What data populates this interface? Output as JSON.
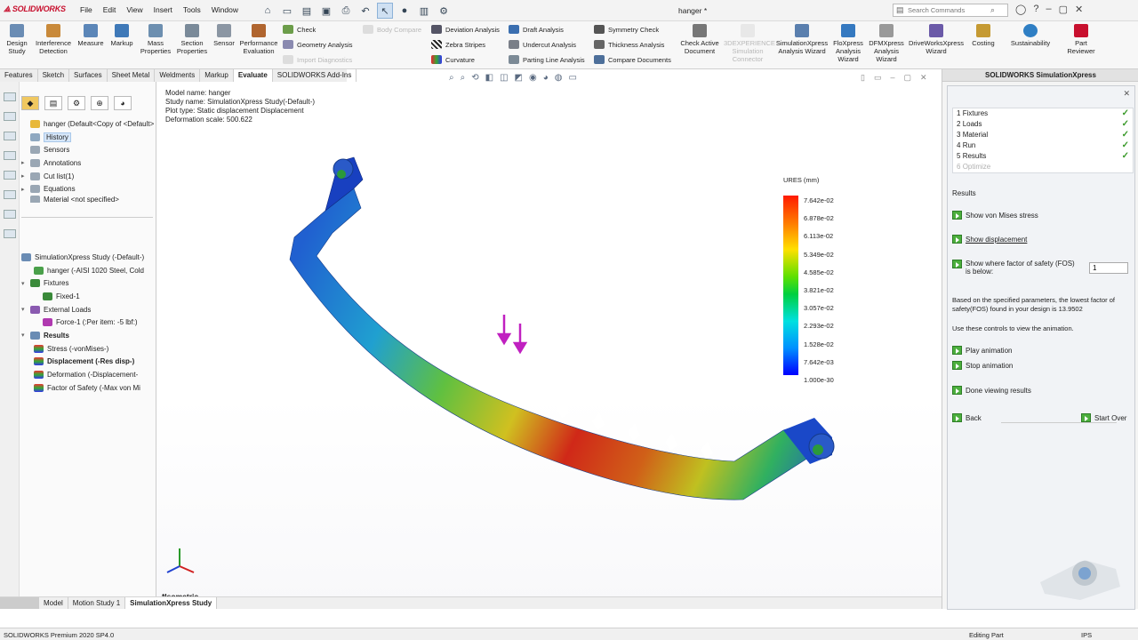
{
  "app": {
    "brand": "SOLIDWORKS",
    "doc_title": "hanger *"
  },
  "menus": [
    "File",
    "Edit",
    "View",
    "Insert",
    "Tools",
    "Window"
  ],
  "search": {
    "placeholder": "Search Commands"
  },
  "ribbon": {
    "buttons": [
      {
        "label": "Design\nStudy"
      },
      {
        "label": "Interference\nDetection"
      },
      {
        "label": "Measure"
      },
      {
        "label": "Markup"
      },
      {
        "label": "Mass\nProperties"
      },
      {
        "label": "Section\nProperties"
      },
      {
        "label": "Sensor"
      },
      {
        "label": "Performance\nEvaluation"
      },
      {
        "label": "Check Active\nDocument"
      },
      {
        "label": "3DEXPERIENCE\nSimulation\nConnector"
      },
      {
        "label": "SimulationXpress\nAnalysis Wizard"
      },
      {
        "label": "FloXpress\nAnalysis\nWizard"
      },
      {
        "label": "DFMXpress\nAnalysis\nWizard"
      },
      {
        "label": "DriveWorksXpress\nWizard"
      },
      {
        "label": "Costing"
      },
      {
        "label": "Sustainability"
      },
      {
        "label": "Part\nReviewer"
      }
    ],
    "small": [
      {
        "label": "Check"
      },
      {
        "label": "Geometry Analysis"
      },
      {
        "label": "Import Diagnostics"
      },
      {
        "label": "Body Compare"
      },
      {
        "label": "Deviation Analysis"
      },
      {
        "label": "Zebra Stripes"
      },
      {
        "label": "Curvature"
      },
      {
        "label": "Draft Analysis"
      },
      {
        "label": "Undercut Analysis"
      },
      {
        "label": "Parting Line Analysis"
      },
      {
        "label": "Symmetry Check"
      },
      {
        "label": "Thickness Analysis"
      },
      {
        "label": "Compare Documents"
      }
    ]
  },
  "tabs": [
    "Features",
    "Sketch",
    "Surfaces",
    "Sheet Metal",
    "Weldments",
    "Markup",
    "Evaluate",
    "SOLIDWORKS Add-Ins"
  ],
  "tree_top": [
    {
      "label": "hanger  (Default<Copy of <Default>"
    },
    {
      "label": "History"
    },
    {
      "label": "Sensors"
    },
    {
      "label": "Annotations"
    },
    {
      "label": "Cut list(1)"
    },
    {
      "label": "Equations"
    },
    {
      "label": "Material <not specified>"
    }
  ],
  "tree_study": [
    {
      "label": "SimulationXpress Study (-Default-)"
    },
    {
      "label": "hanger (-AISI 1020 Steel, Cold"
    },
    {
      "label": "Fixtures"
    },
    {
      "label": "Fixed-1"
    },
    {
      "label": "External Loads"
    },
    {
      "label": "Force-1 (:Per item: -5 lbf:)"
    },
    {
      "label": "Results"
    },
    {
      "label": "Stress (-vonMises-)"
    },
    {
      "label": "Displacement (-Res disp-)"
    },
    {
      "label": "Deformation (-Displacement-"
    },
    {
      "label": "Factor of Safety (-Max von Mi"
    }
  ],
  "viewport": {
    "info": [
      "Model name: hanger",
      "Study name: SimulationXpress Study(-Default-)",
      "Plot type: Static displacement Displacement",
      "Deformation scale: 500.622"
    ],
    "orientation": "*Isometric"
  },
  "legend": {
    "title": "URES (mm)",
    "values": [
      "7.642e-02",
      "6.878e-02",
      "6.113e-02",
      "5.349e-02",
      "4.585e-02",
      "3.821e-02",
      "3.057e-02",
      "2.293e-02",
      "1.528e-02",
      "7.642e-03",
      "1.000e-30"
    ]
  },
  "model_tabs": [
    "Model",
    "Motion Study 1",
    "SimulationXpress Study"
  ],
  "right_panel": {
    "title": "SOLIDWORKS SimulationXpress",
    "steps": [
      {
        "num": "1",
        "label": "Fixtures",
        "done": true
      },
      {
        "num": "2",
        "label": "Loads",
        "done": true
      },
      {
        "num": "3",
        "label": "Material",
        "done": true
      },
      {
        "num": "4",
        "label": "Run",
        "done": true
      },
      {
        "num": "5",
        "label": "Results",
        "done": true
      },
      {
        "num": "6",
        "label": "Optimize",
        "done": false
      }
    ],
    "check": "✓",
    "results_heading": "Results",
    "show_von_mises": "Show von Mises stress",
    "show_displacement": "Show displacement",
    "fos_label": "Show where factor of safety (FOS) is below:",
    "fos_value": "1",
    "fos_text": "Based on the specified parameters, the lowest factor of safety(FOS) found in your design is 13.9502",
    "anim_text": "Use these controls to view the animation.",
    "play": "Play animation",
    "stop": "Stop animation",
    "done": "Done viewing results",
    "back": "Back",
    "start_over": "Start Over"
  },
  "status": {
    "left": "SOLIDWORKS Premium 2020 SP4.0",
    "mode": "Editing Part",
    "units": "IPS"
  },
  "colors": {
    "accent_red": "#c8102e",
    "green_button": "#4caf3d",
    "selection": "#d6e6f8"
  }
}
